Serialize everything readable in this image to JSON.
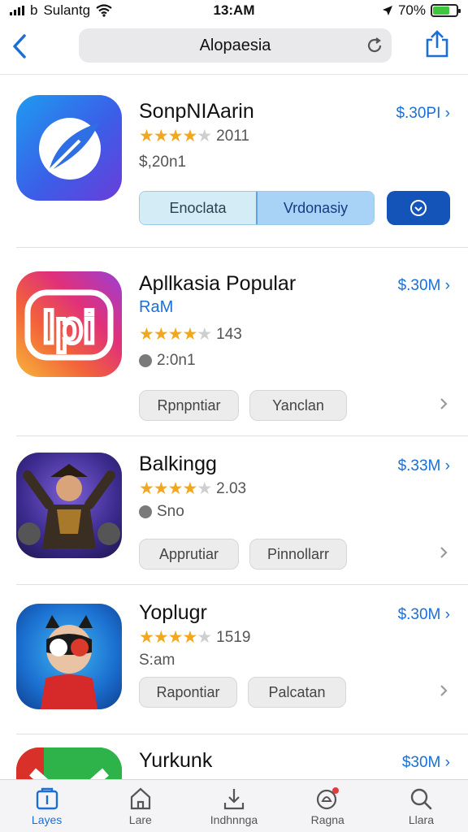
{
  "status": {
    "carrier_prefix": "b",
    "carrier": "Sulantg",
    "time": "13:AM",
    "battery": "70%",
    "battery_level": 0.7
  },
  "navbar": {
    "url_text": "Alopaesia"
  },
  "apps": [
    {
      "title": "SonpNIAarin",
      "price": "$.30PI",
      "rating_text": "2011",
      "stars": 4.5,
      "meta": "$,20n1",
      "seg_left": "Enoclata",
      "seg_right": "Vrdonasiy"
    },
    {
      "title": "Apllkasia Popular",
      "price": "$.30M",
      "subtitle": "RaM",
      "rating_text": "143",
      "stars": 4.5,
      "meta": "2:0n1",
      "btn1": "Rpnpntiar",
      "btn2": "Yanclan"
    },
    {
      "title": "Balkingg",
      "price": "$.33M",
      "rating_text": "2.03",
      "stars": 4.5,
      "meta": "Sno",
      "btn1": "Apprutiar",
      "btn2": "Pinnollarr"
    },
    {
      "title": "Yoplugr",
      "price": "$.30M",
      "rating_text": "1519",
      "stars": 4.5,
      "meta": "S:am",
      "btn1": "Rapontiar",
      "btn2": "Palcatan"
    },
    {
      "title": "Yurkunk",
      "price": "$30M"
    }
  ],
  "tabs": [
    {
      "label": "Layes",
      "icon": "apps-icon",
      "active": true
    },
    {
      "label": "Lare",
      "icon": "home-icon",
      "active": false
    },
    {
      "label": "Indhnnga",
      "icon": "download-icon",
      "active": false
    },
    {
      "label": "Ragna",
      "icon": "bell-icon",
      "active": false
    },
    {
      "label": "Llara",
      "icon": "search-icon",
      "active": false
    }
  ],
  "colors": {
    "accent": "#1a6fd6",
    "star": "#f2a81d",
    "download_button": "#1453b8"
  }
}
